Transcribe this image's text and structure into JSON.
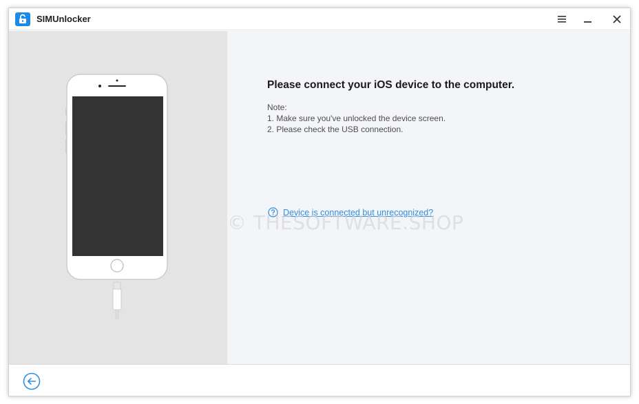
{
  "titlebar": {
    "app_title": "SIMUnlocker",
    "logo_icon": "unlock-logo-icon",
    "menu_icon": "hamburger-menu-icon",
    "minimize_icon": "minimize-icon",
    "close_icon": "close-icon"
  },
  "main": {
    "heading": "Please connect your iOS device to the computer.",
    "note_title": "Note:",
    "notes": [
      "1. Make sure you've unlocked the device screen.",
      "2. Please check the USB connection."
    ],
    "help_link": "Device is connected but unrecognized?",
    "help_icon": "question-circle-icon",
    "watermark": "© THESOFTWARE.SHOP"
  },
  "footer": {
    "back_icon": "back-arrow-icon"
  },
  "colors": {
    "accent": "#2f8fe0",
    "left_panel": "#e4e4e4",
    "content_bg": "#f4f5f8"
  }
}
